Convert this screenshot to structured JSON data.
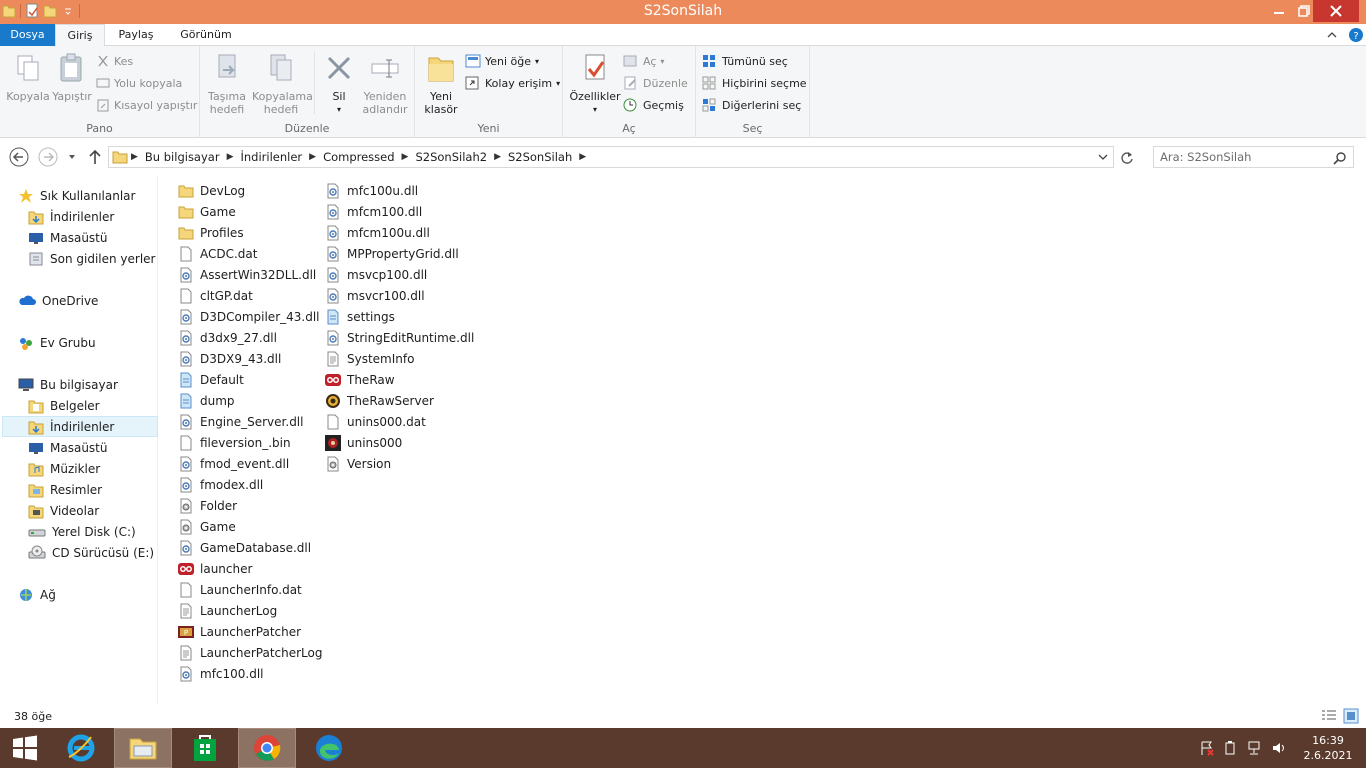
{
  "window": {
    "title": "S2SonSilah"
  },
  "ribbon_tabs": [
    "Dosya",
    "Giriş",
    "Paylaş",
    "Görünüm"
  ],
  "ribbon": {
    "pano": {
      "label": "Pano",
      "kopyala": "Kopyala",
      "yapistir": "Yapıştır",
      "kes": "Kes",
      "yolu_kopyala": "Yolu kopyala",
      "kisayol": "Kısayol yapıştır"
    },
    "duzenle": {
      "label": "Düzenle",
      "tasima_1": "Taşıma",
      "tasima_2": "hedefi",
      "kopyalama_1": "Kopyalama",
      "kopyalama_2": "hedefi",
      "sil": "Sil",
      "yeniden_1": "Yeniden",
      "yeniden_2": "adlandır"
    },
    "yeni": {
      "label": "Yeni",
      "yeni_klasor_1": "Yeni",
      "yeni_klasor_2": "klasör",
      "yeni_oge": "Yeni öğe",
      "kolay_erisim": "Kolay erişim"
    },
    "ac": {
      "label": "Aç",
      "ozellikler": "Özellikler",
      "ac": "Aç",
      "duzenle": "Düzenle",
      "gecmis": "Geçmiş"
    },
    "sec": {
      "label": "Seç",
      "tumunu": "Tümünü seç",
      "hicbirini": "Hiçbirini seçme",
      "digerlerini": "Diğerlerini seç"
    }
  },
  "breadcrumb": [
    "Bu bilgisayar",
    "İndirilenler",
    "Compressed",
    "S2SonSilah2",
    "S2SonSilah"
  ],
  "search": {
    "placeholder": "Ara: S2SonSilah"
  },
  "nav": {
    "favorites": "Sık Kullanılanlar",
    "fav_items": [
      "İndirilenler",
      "Masaüstü",
      "Son gidilen yerler"
    ],
    "onedrive": "OneDrive",
    "homegroup": "Ev Grubu",
    "thispc": "Bu bilgisayar",
    "pc_items": [
      "Belgeler",
      "İndirilenler",
      "Masaüstü",
      "Müzikler",
      "Resimler",
      "Videolar",
      "Yerel Disk (C:)",
      "CD Sürücüsü (E:)"
    ],
    "network": "Ağ"
  },
  "files_col1": [
    {
      "name": "DevLog",
      "icon": "folder-icon"
    },
    {
      "name": "Game",
      "icon": "folder-icon"
    },
    {
      "name": "Profiles",
      "icon": "folder-icon"
    },
    {
      "name": "ACDC.dat",
      "icon": "file-icon"
    },
    {
      "name": "AssertWin32DLL.dll",
      "icon": "dll-icon"
    },
    {
      "name": "cltGP.dat",
      "icon": "file-icon"
    },
    {
      "name": "D3DCompiler_43.dll",
      "icon": "dll-icon"
    },
    {
      "name": "d3dx9_27.dll",
      "icon": "dll-icon"
    },
    {
      "name": "D3DX9_43.dll",
      "icon": "dll-icon"
    },
    {
      "name": "Default",
      "icon": "config-icon"
    },
    {
      "name": "dump",
      "icon": "config-icon"
    },
    {
      "name": "Engine_Server.dll",
      "icon": "dll-icon"
    },
    {
      "name": "fileversion_.bin",
      "icon": "file-icon"
    },
    {
      "name": "fmod_event.dll",
      "icon": "dll-icon"
    },
    {
      "name": "fmodex.dll",
      "icon": "dll-icon"
    },
    {
      "name": "Folder",
      "icon": "settings-file-icon"
    },
    {
      "name": "Game",
      "icon": "settings-file-icon"
    },
    {
      "name": "GameDatabase.dll",
      "icon": "dll-icon"
    },
    {
      "name": "launcher",
      "icon": "launcher-icon"
    },
    {
      "name": "LauncherInfo.dat",
      "icon": "file-icon"
    },
    {
      "name": "LauncherLog",
      "icon": "text-file-icon"
    },
    {
      "name": "LauncherPatcher",
      "icon": "patcher-icon"
    },
    {
      "name": "LauncherPatcherLog",
      "icon": "text-file-icon"
    },
    {
      "name": "mfc100.dll",
      "icon": "dll-icon"
    }
  ],
  "files_col2": [
    {
      "name": "mfc100u.dll",
      "icon": "dll-icon"
    },
    {
      "name": "mfcm100.dll",
      "icon": "dll-icon"
    },
    {
      "name": "mfcm100u.dll",
      "icon": "dll-icon"
    },
    {
      "name": "MPPropertyGrid.dll",
      "icon": "dll-icon"
    },
    {
      "name": "msvcp100.dll",
      "icon": "dll-icon"
    },
    {
      "name": "msvcr100.dll",
      "icon": "dll-icon"
    },
    {
      "name": "settings",
      "icon": "config-icon"
    },
    {
      "name": "StringEditRuntime.dll",
      "icon": "dll-icon"
    },
    {
      "name": "SystemInfo",
      "icon": "text-file-icon"
    },
    {
      "name": "TheRaw",
      "icon": "launcher-icon"
    },
    {
      "name": "TheRawServer",
      "icon": "server-icon"
    },
    {
      "name": "unins000.dat",
      "icon": "file-icon"
    },
    {
      "name": "unins000",
      "icon": "uninstall-icon"
    },
    {
      "name": "Version",
      "icon": "settings-file-icon"
    }
  ],
  "status": {
    "count": "38 öğe"
  },
  "clock": {
    "time": "16:39",
    "date": "2.6.2021"
  },
  "colors": {
    "titlebar": "#ec8a5b",
    "file_tab": "#1979ca",
    "taskbar": "#5a3a2c",
    "close": "#c7372f"
  }
}
